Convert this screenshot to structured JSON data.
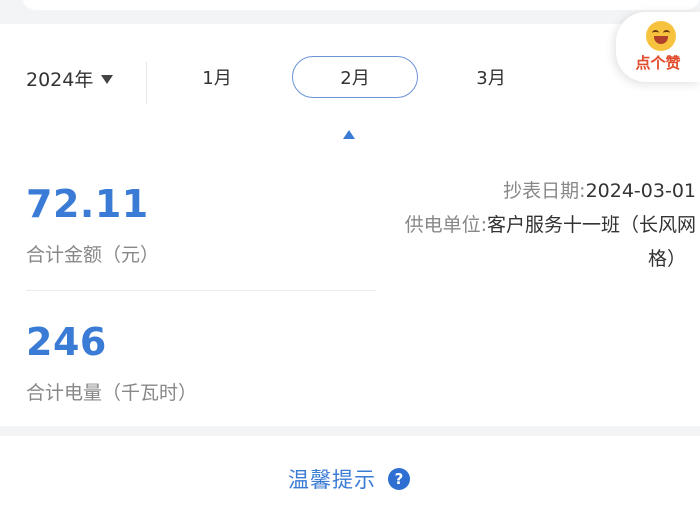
{
  "period": {
    "year_label": "2024年",
    "months": [
      {
        "label": "1月",
        "active": false
      },
      {
        "label": "2月",
        "active": true
      },
      {
        "label": "3月",
        "active": false
      }
    ]
  },
  "summary": {
    "amount_value": "72.11",
    "amount_caption": "合计金额（元）",
    "energy_value": "246",
    "energy_caption": "合计电量（千瓦时）"
  },
  "meter_info": {
    "reading_date_label": "抄表日期:",
    "reading_date_value": "2024-03-01",
    "supply_unit_label": "供电单位:",
    "supply_unit_value_line1": "客户服务十一班（长风网",
    "supply_unit_value_line2": "格）"
  },
  "praise": {
    "label": "点个赞",
    "icon": "smile-emoji-icon"
  },
  "tips": {
    "label": "温馨提示",
    "icon": "help-icon",
    "icon_glyph": "?"
  },
  "colors": {
    "accent": "#3a7bd5",
    "active_border": "#6b93d6",
    "praise": "#e24b2c"
  }
}
